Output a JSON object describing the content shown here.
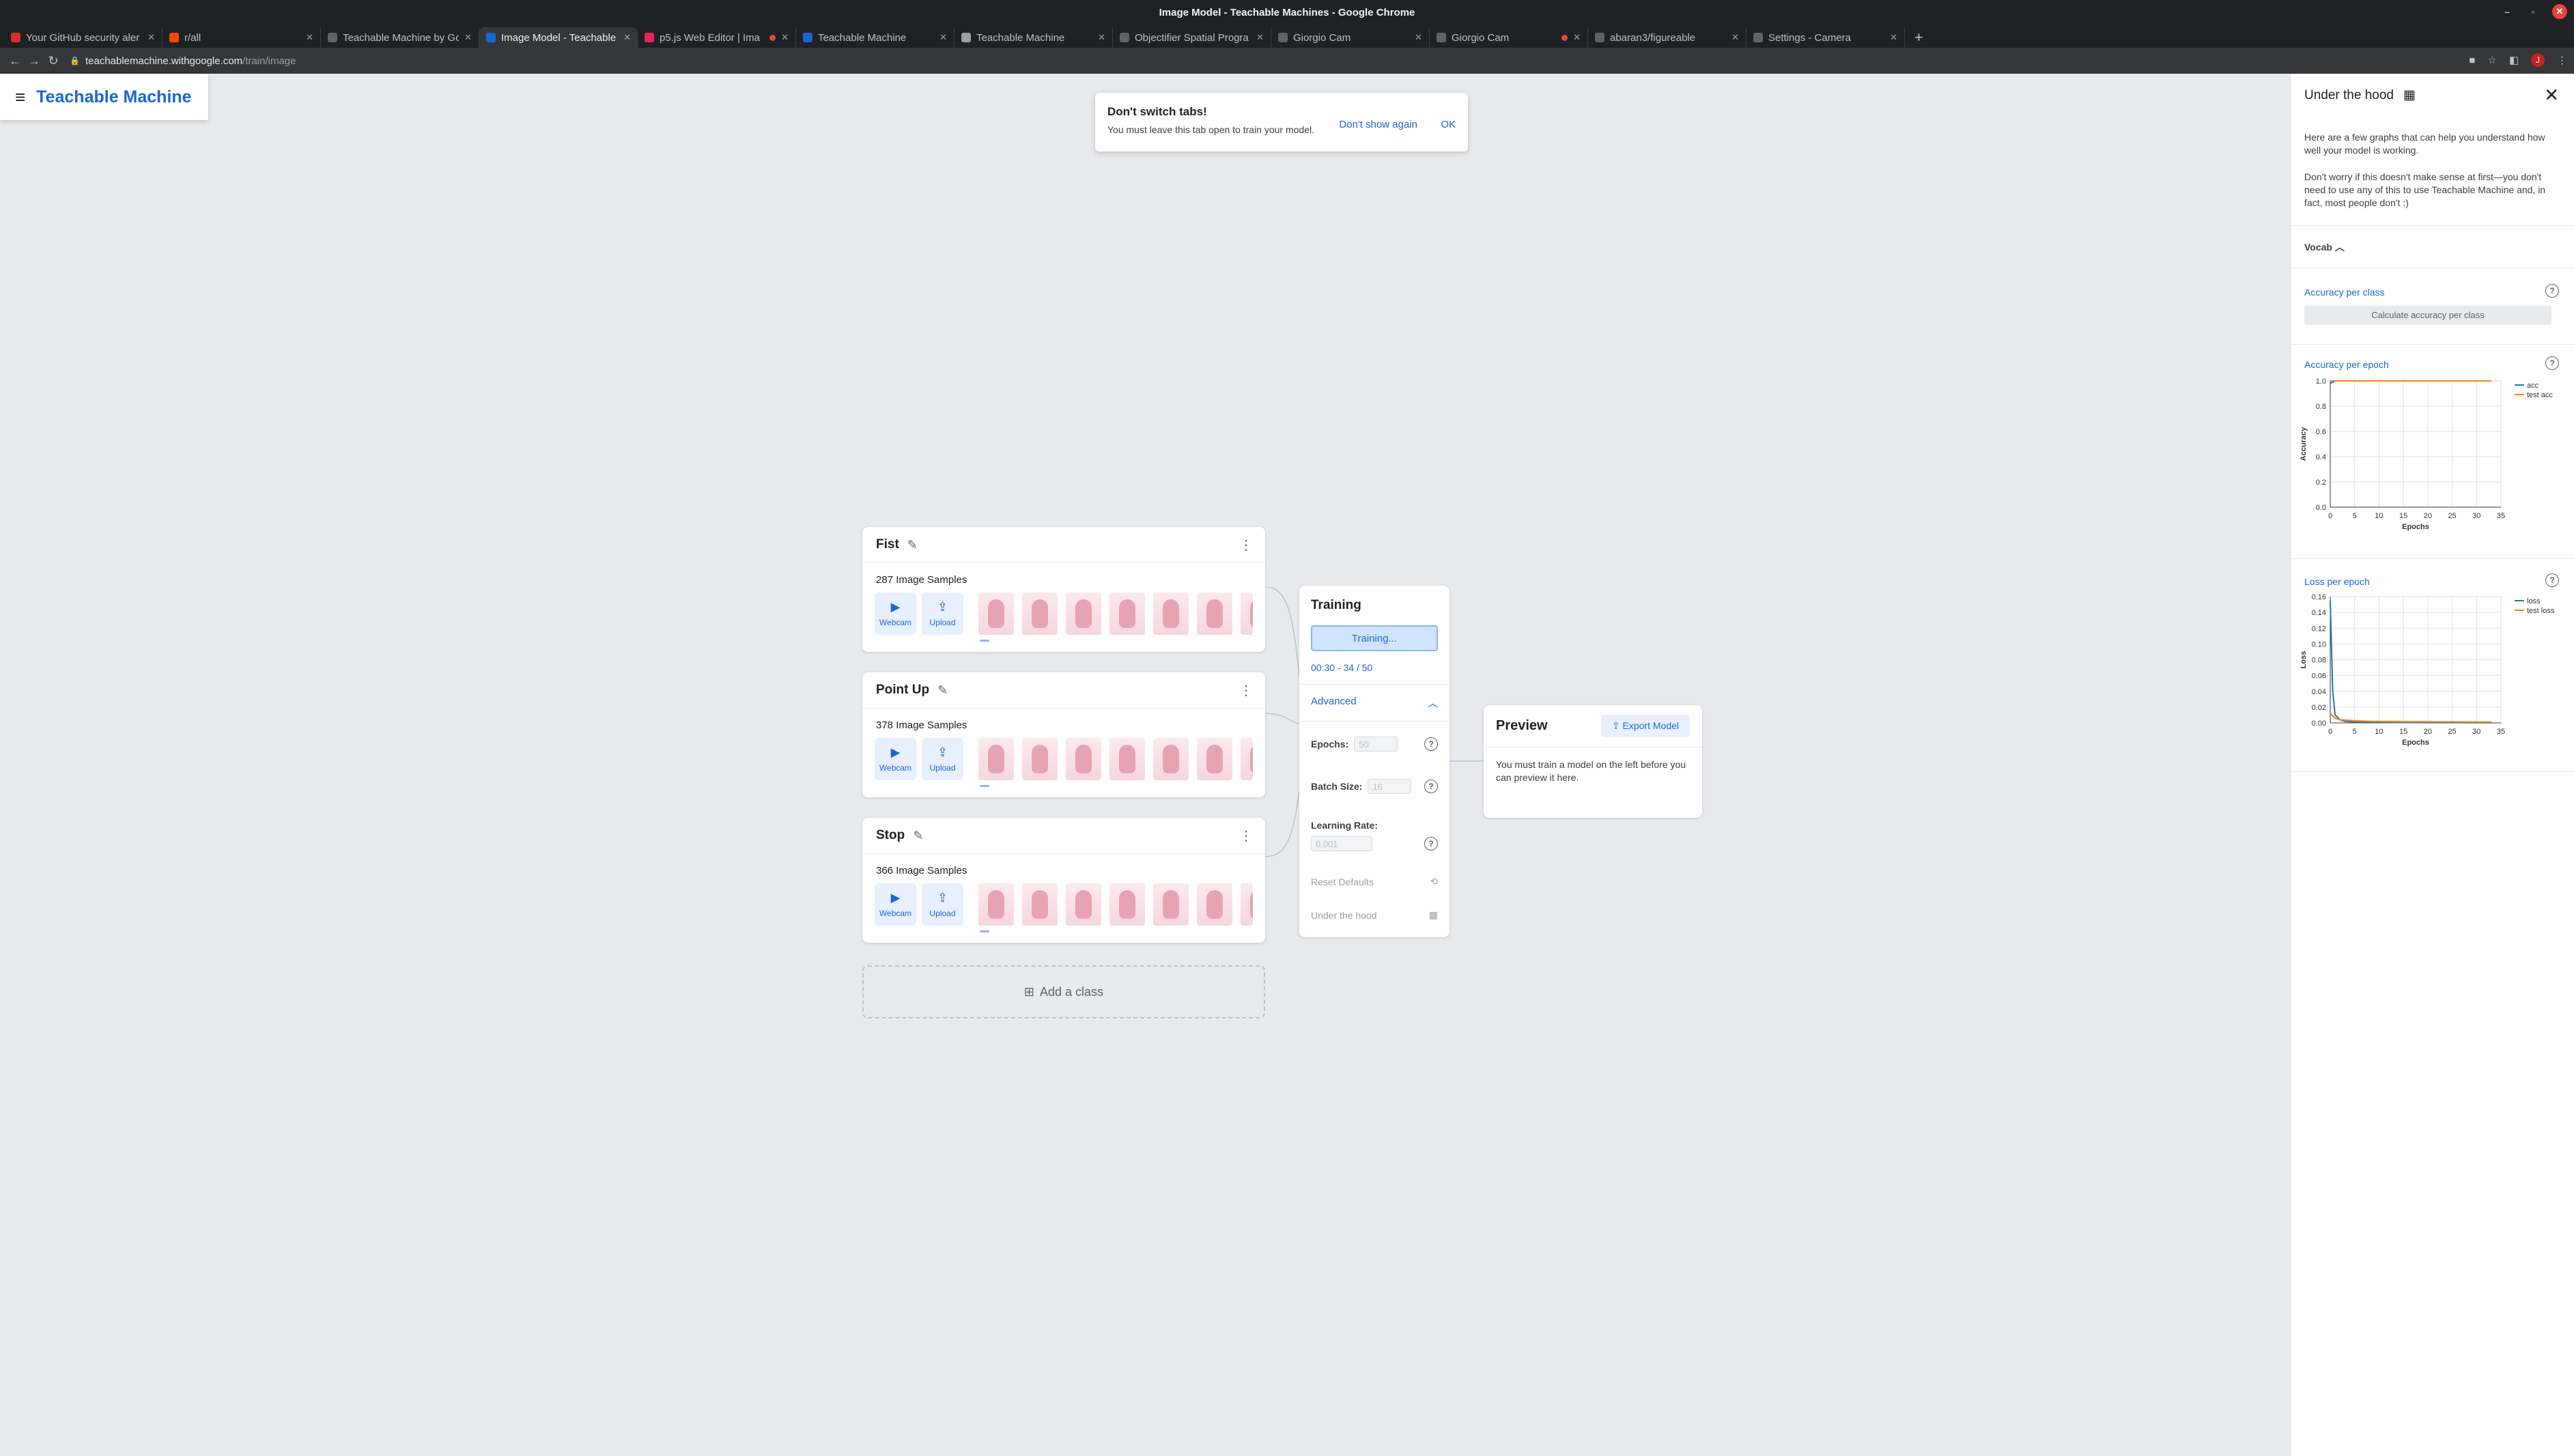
{
  "window": {
    "title": "Image Model - Teachable Machines - Google Chrome"
  },
  "tabs": [
    {
      "title": "Your GitHub security aler",
      "favicon_color": "#d93025",
      "active": false,
      "recording": false
    },
    {
      "title": "r/all",
      "favicon_color": "#ff4500",
      "active": false,
      "recording": false
    },
    {
      "title": "Teachable Machine by Go",
      "favicon_color": "#5f6368",
      "active": false,
      "recording": false
    },
    {
      "title": "Image Model - Teachable",
      "favicon_color": "#1967d2",
      "active": true,
      "recording": false
    },
    {
      "title": "p5.js Web Editor | Ima",
      "favicon_color": "#ed225d",
      "active": false,
      "recording": true
    },
    {
      "title": "Teachable Machine",
      "favicon_color": "#1967d2",
      "active": false,
      "recording": false
    },
    {
      "title": "Teachable Machine",
      "favicon_color": "#9aa0a6",
      "active": false,
      "recording": false
    },
    {
      "title": "Objectifier Spatial Progra",
      "favicon_color": "#5f6368",
      "active": false,
      "recording": false
    },
    {
      "title": "Giorgio Cam",
      "favicon_color": "#5f6368",
      "active": false,
      "recording": false
    },
    {
      "title": "Giorgio Cam",
      "favicon_color": "#5f6368",
      "active": false,
      "recording": true
    },
    {
      "title": "abaran3/figureable",
      "favicon_color": "#5f6368",
      "active": false,
      "recording": false
    },
    {
      "title": "Settings - Camera",
      "favicon_color": "#5f6368",
      "active": false,
      "recording": false
    }
  ],
  "address_bar": {
    "host": "teachablemachine.withgoogle.com",
    "path": "/train/image"
  },
  "app": {
    "brand": "Teachable Machine"
  },
  "snackbar": {
    "title": "Don't switch tabs!",
    "message": "You must leave this tab open to train your model.",
    "dismiss_label": "Don't show again",
    "ok_label": "OK"
  },
  "classes": [
    {
      "name": "Fist",
      "samples": "287 Image Samples"
    },
    {
      "name": "Point Up",
      "samples": "378 Image Samples"
    },
    {
      "name": "Stop",
      "samples": "366 Image Samples"
    }
  ],
  "class_buttons": {
    "webcam": "Webcam",
    "upload": "Upload"
  },
  "add_class": "Add a class",
  "training": {
    "title": "Training",
    "button": "Training...",
    "status": "00:30 - 34 / 50",
    "advanced": "Advanced",
    "epochs_label": "Epochs:",
    "epochs_value": "50",
    "batch_label": "Batch Size:",
    "batch_value": "16",
    "lr_label": "Learning Rate:",
    "lr_value": "0.001",
    "reset": "Reset Defaults",
    "under_hood": "Under the hood"
  },
  "preview": {
    "title": "Preview",
    "export": "Export Model",
    "message": "You must train a model on the left before you can preview it here."
  },
  "panel": {
    "title": "Under the hood",
    "intro1": "Here are a few graphs that can help you understand how well your model is working.",
    "intro2": "Don't worry if this doesn't make sense at first—you don't need to use any of this to use Teachable Machine and, in fact, most people don't :)",
    "vocab": "Vocab",
    "acc_per_class": "Accuracy per class",
    "calc_button": "Calculate accuracy per class",
    "acc_per_epoch": "Accuracy per epoch",
    "loss_per_epoch": "Loss per epoch"
  },
  "chart_data": [
    {
      "type": "line",
      "ylabel": "Accuracy",
      "xlabel": "Epochs",
      "xlim": [
        0,
        35
      ],
      "ylim": [
        0,
        1.0
      ],
      "xticks": [
        0,
        5,
        10,
        15,
        20,
        25,
        30,
        35
      ],
      "yticks": [
        "0.0",
        "0.2",
        "0.4",
        "0.6",
        "0.8",
        "1.0"
      ],
      "legend_position": "top-right",
      "grid": true,
      "series": [
        {
          "name": "acc",
          "color": "#1f77b4",
          "x": [
            0,
            1,
            2,
            33
          ],
          "y": [
            0.98,
            1.0,
            1.0,
            1.0
          ]
        },
        {
          "name": "test acc",
          "color": "#ff7f0e",
          "x": [
            0,
            33
          ],
          "y": [
            1.0,
            1.0
          ]
        }
      ]
    },
    {
      "type": "line",
      "ylabel": "Loss",
      "xlabel": "Epochs",
      "xlim": [
        0,
        35
      ],
      "ylim": [
        0,
        0.16
      ],
      "xticks": [
        0,
        5,
        10,
        15,
        20,
        25,
        30,
        35
      ],
      "yticks": [
        "0.00",
        "0.02",
        "0.04",
        "0.06",
        "0.08",
        "0.10",
        "0.12",
        "0.14",
        "0.16"
      ],
      "legend_position": "top-right",
      "grid": true,
      "series": [
        {
          "name": "loss",
          "color": "#1f77b4",
          "x": [
            0,
            0.5,
            1,
            2,
            3,
            5,
            10,
            20,
            33
          ],
          "y": [
            0.155,
            0.04,
            0.01,
            0.004,
            0.002,
            0.001,
            0.0005,
            0.0003,
            0.0002
          ]
        },
        {
          "name": "test loss",
          "color": "#ff7f0e",
          "x": [
            0,
            1,
            2,
            4,
            8,
            15,
            33
          ],
          "y": [
            0.012,
            0.006,
            0.004,
            0.003,
            0.002,
            0.0015,
            0.001
          ]
        }
      ]
    }
  ]
}
